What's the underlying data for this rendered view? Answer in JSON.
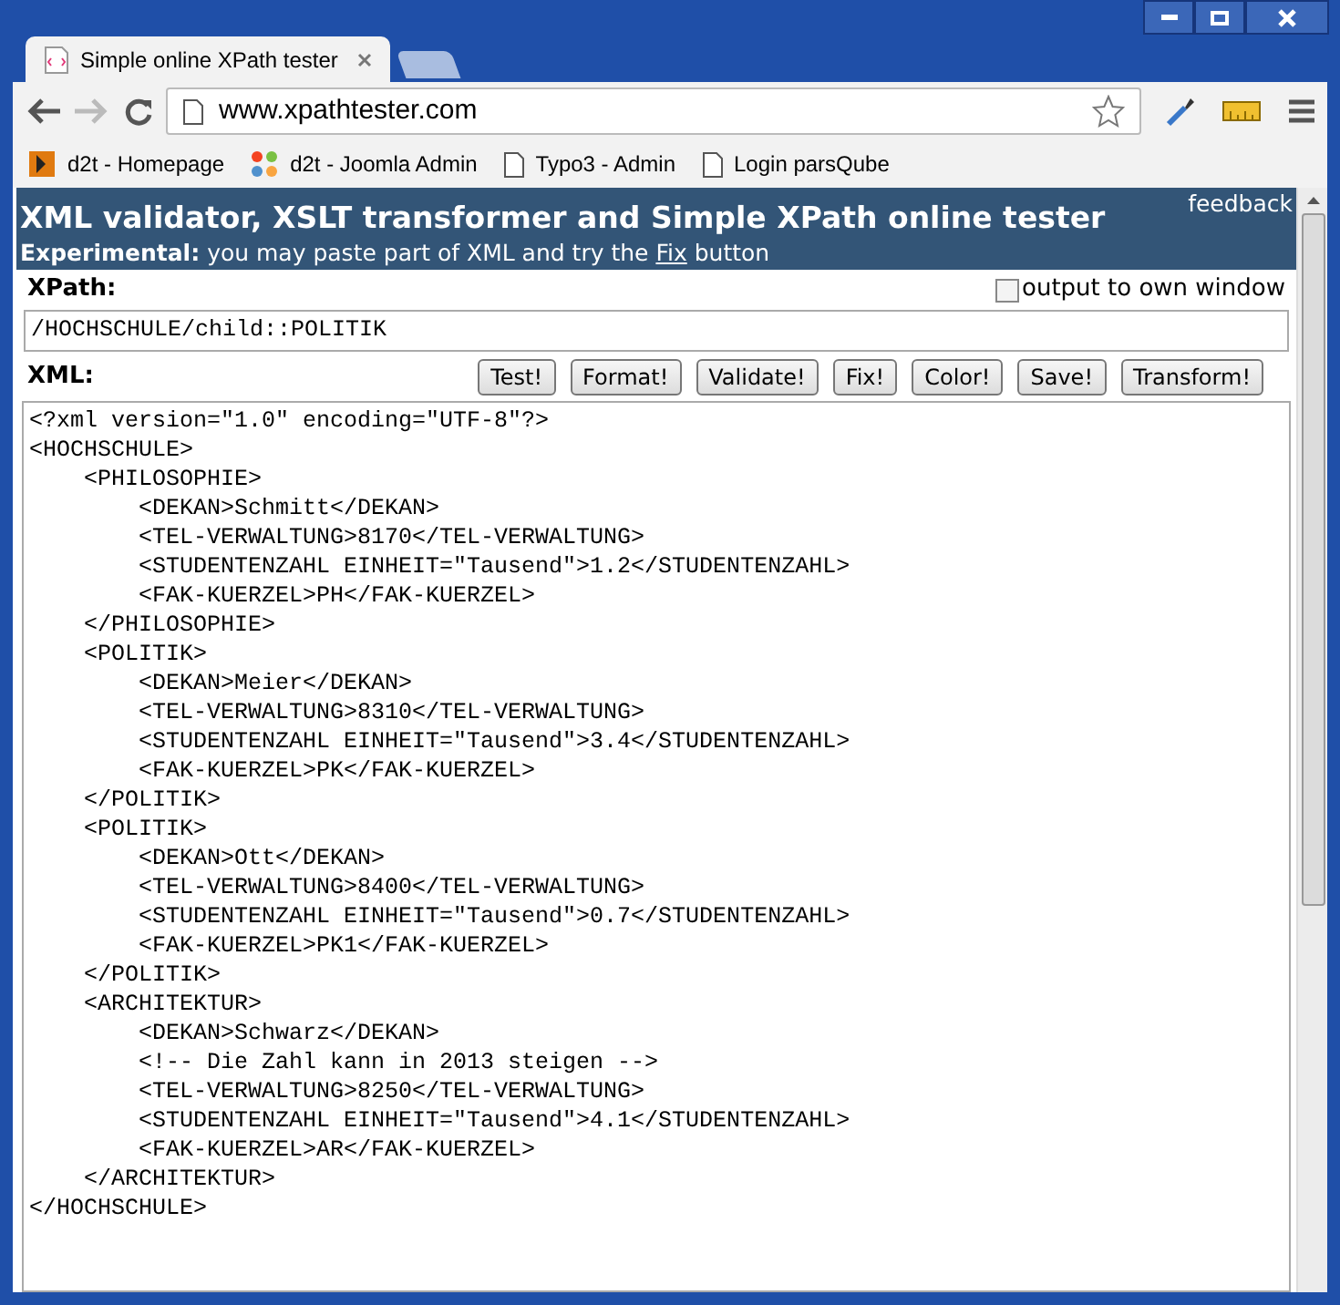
{
  "tab": {
    "title": "Simple online XPath tester",
    "selected": true
  },
  "address": "www.xpathtester.com",
  "bookmarks": [
    {
      "label": "d2t - Homepage",
      "kind": "site"
    },
    {
      "label": "d2t - Joomla Admin",
      "kind": "joomla"
    },
    {
      "label": "Typo3 - Admin",
      "kind": "page"
    },
    {
      "label": "Login parsQube",
      "kind": "page"
    }
  ],
  "header": {
    "title": "XML validator, XSLT transformer and Simple XPath online tester",
    "feedback": "feedback",
    "note_label": "Experimental:",
    "note_before": "you may paste part of XML and try the",
    "note_link": "Fix",
    "note_after": "button"
  },
  "xpath": {
    "label": "XPath:",
    "value": "/HOCHSCHULE/child::POLITIK",
    "own_window": {
      "label": "output to own window",
      "checked": false
    }
  },
  "xml": {
    "label": "XML:",
    "buttons": [
      "Test!",
      "Format!",
      "Validate!",
      "Fix!",
      "Color!",
      "Save!",
      "Transform!"
    ],
    "value": "<?xml version=\"1.0\" encoding=\"UTF-8\"?>\n<HOCHSCHULE>\n    <PHILOSOPHIE>\n        <DEKAN>Schmitt</DEKAN>\n        <TEL-VERWALTUNG>8170</TEL-VERWALTUNG>\n        <STUDENTENZAHL EINHEIT=\"Tausend\">1.2</STUDENTENZAHL>\n        <FAK-KUERZEL>PH</FAK-KUERZEL>\n    </PHILOSOPHIE>\n    <POLITIK>\n        <DEKAN>Meier</DEKAN>\n        <TEL-VERWALTUNG>8310</TEL-VERWALTUNG>\n        <STUDENTENZAHL EINHEIT=\"Tausend\">3.4</STUDENTENZAHL>\n        <FAK-KUERZEL>PK</FAK-KUERZEL>\n    </POLITIK>\n    <POLITIK>\n        <DEKAN>Ott</DEKAN>\n        <TEL-VERWALTUNG>8400</TEL-VERWALTUNG>\n        <STUDENTENZAHL EINHEIT=\"Tausend\">0.7</STUDENTENZAHL>\n        <FAK-KUERZEL>PK1</FAK-KUERZEL>\n    </POLITIK>\n    <ARCHITEKTUR>\n        <DEKAN>Schwarz</DEKAN>\n        <!-- Die Zahl kann in 2013 steigen -->\n        <TEL-VERWALTUNG>8250</TEL-VERWALTUNG>\n        <STUDENTENZAHL EINHEIT=\"Tausend\">4.1</STUDENTENZAHL>\n        <FAK-KUERZEL>AR</FAK-KUERZEL>\n    </ARCHITEKTUR>\n</HOCHSCHULE>"
  }
}
